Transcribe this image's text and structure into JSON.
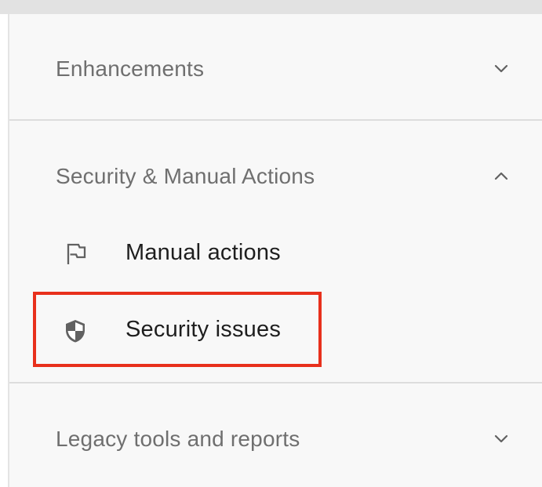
{
  "sections": {
    "enhancements": {
      "label": "Enhancements",
      "expanded": false,
      "chevron_icon": "chevron-down-icon"
    },
    "security_manual_actions": {
      "label": "Security & Manual Actions",
      "expanded": true,
      "chevron_icon": "chevron-up-icon",
      "items": [
        {
          "label": "Manual actions",
          "icon": "flag-icon"
        },
        {
          "label": "Security issues",
          "icon": "shield-icon",
          "highlighted": true
        }
      ]
    },
    "legacy_tools": {
      "label": "Legacy tools and reports",
      "expanded": false,
      "chevron_icon": "chevron-down-icon"
    }
  },
  "colors": {
    "panel_background": "#f8f8f8",
    "section_text": "#6f6f6f",
    "item_text": "#1e1e1e",
    "icon": "#616161",
    "divider": "#dddddd",
    "highlight_border": "#e8301c"
  }
}
